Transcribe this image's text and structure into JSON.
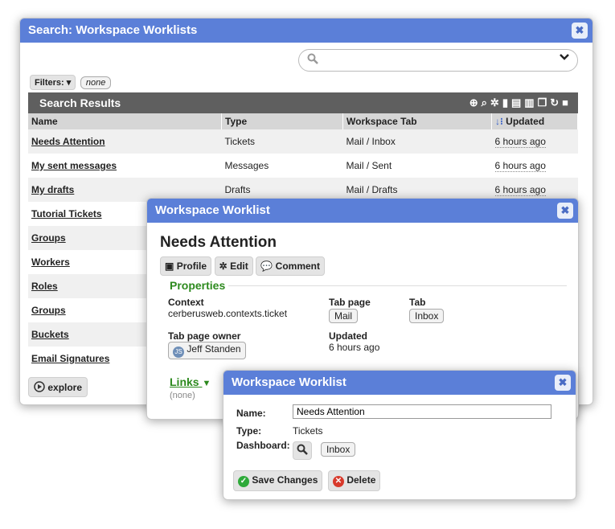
{
  "search_panel": {
    "title": "Search: Workspace Worklists",
    "close_glyph": "✖",
    "search_icon": "magnifier-icon",
    "dropdown_glyph": "⌄",
    "filters_label": "Filters: ▾",
    "filter_value": "none",
    "results_title": "Search Results",
    "columns": [
      "Name",
      "Type",
      "Workspace Tab",
      "Updated"
    ],
    "rows": [
      {
        "name": "Needs Attention",
        "type": "Tickets",
        "tab": "Mail / Inbox",
        "updated": "6 hours ago"
      },
      {
        "name": "My sent messages",
        "type": "Messages",
        "tab": "Mail / Sent",
        "updated": "6 hours ago"
      },
      {
        "name": "My drafts",
        "type": "Drafts",
        "tab": "Mail / Drafts",
        "updated": "6 hours ago"
      },
      {
        "name": "Tutorial Tickets",
        "type": "",
        "tab": "",
        "updated": ""
      },
      {
        "name": "Groups",
        "type": "",
        "tab": "",
        "updated": ""
      },
      {
        "name": "Workers",
        "type": "",
        "tab": "",
        "updated": ""
      },
      {
        "name": "Roles",
        "type": "",
        "tab": "",
        "updated": ""
      },
      {
        "name": "Groups",
        "type": "",
        "tab": "",
        "updated": ""
      },
      {
        "name": "Buckets",
        "type": "",
        "tab": "",
        "updated": ""
      },
      {
        "name": "Email Signatures",
        "type": "",
        "tab": "",
        "updated": ""
      }
    ],
    "explore_label": "explore"
  },
  "worklist_panel": {
    "title": "Workspace Worklist",
    "heading": "Needs Attention",
    "buttons": {
      "profile": "Profile",
      "edit": "Edit",
      "comment": "Comment"
    },
    "properties_label": "Properties",
    "context_label": "Context",
    "context_value": "cerberusweb.contexts.ticket",
    "tab_page_label": "Tab page",
    "tab_page_value": "Mail",
    "tab_label": "Tab",
    "tab_value": "Inbox",
    "owner_label": "Tab page owner",
    "owner_value": "Jeff Standen",
    "owner_initials": "JS",
    "updated_label": "Updated",
    "updated_value": "6 hours ago",
    "links_label": "Links",
    "links_value": "(none)"
  },
  "edit_panel": {
    "title": "Workspace Worklist",
    "name_label": "Name:",
    "name_value": "Needs Attention",
    "type_label": "Type:",
    "type_value": "Tickets",
    "dashboard_label": "Dashboard:",
    "dashboard_value": "Inbox",
    "save_label": "Save Changes",
    "delete_label": "Delete"
  },
  "colors": {
    "titlebar": "#5b7fd8",
    "section": "#2d8a1e",
    "save": "#2eaa3a",
    "delete": "#d83a2c"
  }
}
